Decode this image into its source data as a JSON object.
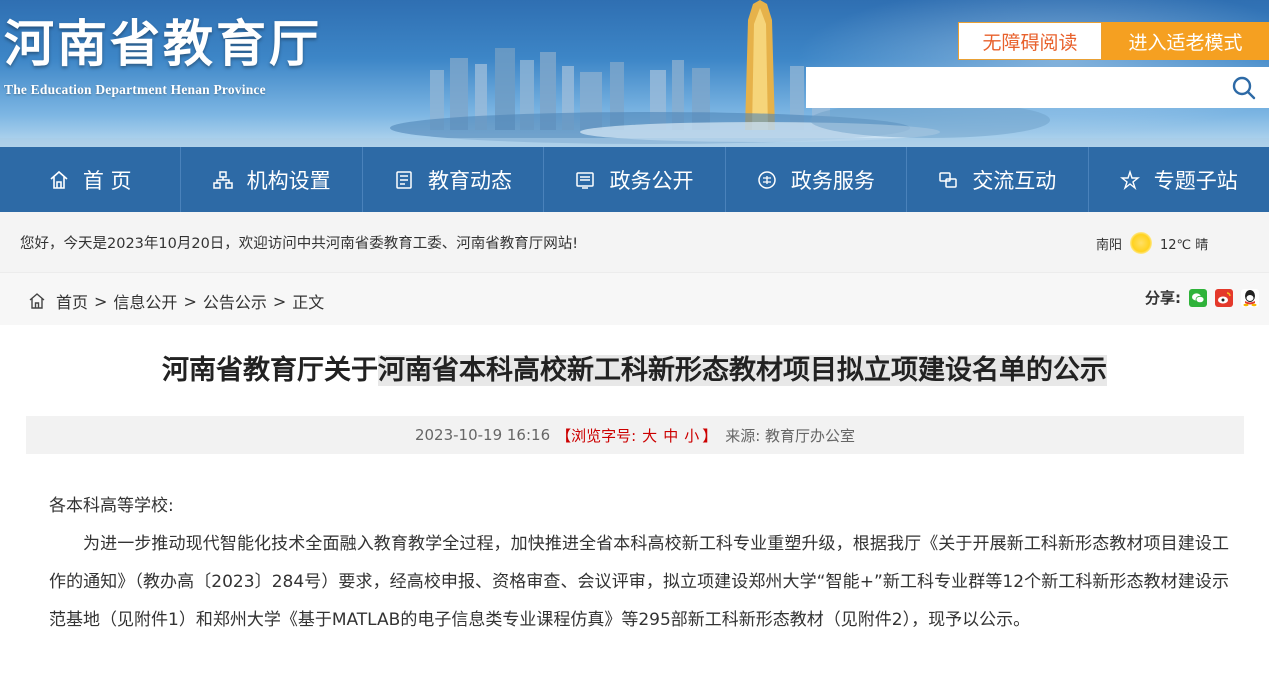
{
  "header": {
    "logo_cn": "河南省教育厅",
    "logo_en": "The Education Department Henan Province",
    "accessibility_label": "无障碍阅读",
    "elder_mode_label": "进入适老模式",
    "search_placeholder": "",
    "search_icon": "search-icon"
  },
  "nav": {
    "items": [
      {
        "label": "首 页",
        "icon": "home-icon"
      },
      {
        "label": "机构设置",
        "icon": "org-icon"
      },
      {
        "label": "教育动态",
        "icon": "news-icon"
      },
      {
        "label": "政务公开",
        "icon": "public-icon"
      },
      {
        "label": "政务服务",
        "icon": "service-icon"
      },
      {
        "label": "交流互动",
        "icon": "interact-icon"
      },
      {
        "label": "专题子站",
        "icon": "topic-icon"
      }
    ]
  },
  "infobar": {
    "welcome": "您好，今天是2023年10月20日，欢迎访问中共河南省委教育工委、河南省教育厅网站!",
    "city": "南阳",
    "temp": "12℃ 晴"
  },
  "breadcrumb": {
    "home": "首页",
    "items": [
      "信息公开",
      "公告公示",
      "正文"
    ],
    "share_label": "分享:"
  },
  "article": {
    "title_prefix": "河南省教育厅关于",
    "title_highlight": "河南省本科高校新工科新形态教材项目拟立项建设名单的公示",
    "datetime": "2023-10-19 16:16",
    "font_label": "【浏览字号:",
    "font_sizes": [
      "大",
      "中",
      "小"
    ],
    "font_close": "】",
    "source": "来源: 教育厅办公室",
    "salutation": "各本科高等学校:",
    "paragraph": "为进一步推动现代智能化技术全面融入教育教学全过程，加快推进全省本科高校新工科专业重塑升级，根据我厅《关于开展新工科新形态教材项目建设工作的通知》（教办高〔2023〕284号）要求，经高校申报、资格审查、会议评审，拟立项建设郑州大学“智能+”新工科专业群等12个新工科新形态教材建设示范基地（见附件1）和郑州大学《基于MATLAB的电子信息类专业课程仿真》等295部新工科新形态教材（见附件2），现予以公示。"
  },
  "colors": {
    "nav_bg": "#2d6aa6",
    "elder_btn": "#f5a021",
    "accessibility_text": "#e8612c",
    "accent_red": "#c00"
  }
}
